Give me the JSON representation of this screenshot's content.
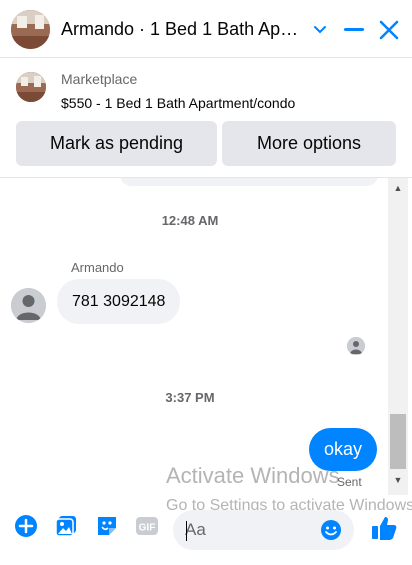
{
  "header": {
    "title": "Armando · 1 Bed 1 Bath Ap…",
    "minimize_icon": "minimize-icon",
    "chevron_icon": "chevron-down-icon",
    "close_icon": "close-icon"
  },
  "marketplace": {
    "label": "Marketplace",
    "listing": "$550 - 1 Bed 1 Bath Apartment/condo",
    "buttons": {
      "pending": "Mark as pending",
      "more": "More options"
    }
  },
  "chat": {
    "timestamp_1": "12:48 AM",
    "sender_name": "Armando",
    "incoming_message": "781 3092148",
    "timestamp_2": "3:37 PM",
    "outgoing_message": "okay",
    "status": "Sent"
  },
  "watermark": {
    "line1": "Activate Windows",
    "line2": "Go to Settings to activate Windows."
  },
  "composer": {
    "placeholder": "Aa",
    "tools": [
      "plus-icon",
      "photo-icon",
      "sticker-icon",
      "gif-icon"
    ],
    "emoji_icon": "emoji-icon",
    "like_icon": "thumbs-up-icon"
  },
  "colors": {
    "accent": "#0084ff",
    "bubble_gray": "#f0f2f5",
    "button_gray": "#e4e6eb",
    "meta_gray": "#65676b"
  }
}
